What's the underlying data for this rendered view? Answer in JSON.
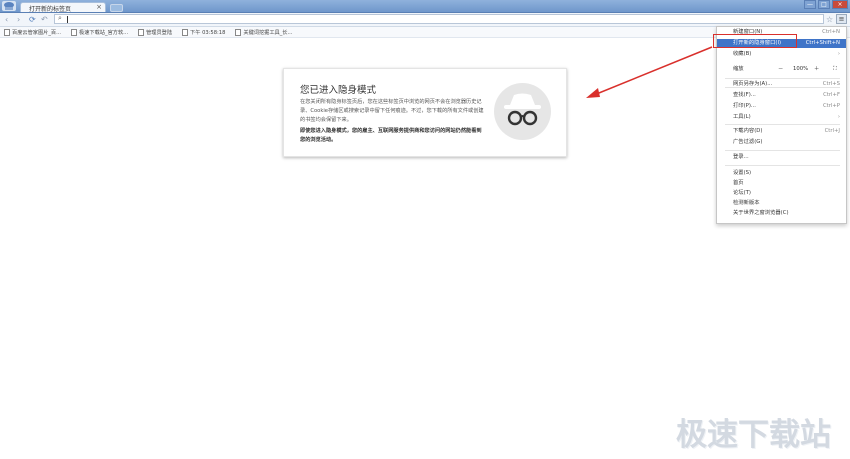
{
  "tab": {
    "title": "打开新的标签页",
    "close": "×"
  },
  "window_controls": {
    "minimize": "—",
    "maximize": "□",
    "close": "×"
  },
  "toolbar": {
    "back": "‹",
    "forward": "›",
    "reload": "⟳",
    "undo": "↶",
    "search": "⌕",
    "star": "☆",
    "menu": "≡"
  },
  "bookmarks": [
    {
      "label": "百度云管家图片_百..."
    },
    {
      "label": "极速下载站_官方软..."
    },
    {
      "label": "管理员登陆"
    },
    {
      "label": "下午 03:58:18"
    },
    {
      "label": "关键词挖掘工具_长..."
    }
  ],
  "card": {
    "title": "您已进入隐身模式",
    "text": "在您关闭所有隐身标签页后，您在这些标签页中浏览的网页不会在浏览器历史记录、Cookie存储区或搜索记录中留下任何痕迹。不过，您下载的所有文件或创建的书签均会保留下来。",
    "bold": "即使您进入隐身模式，您的雇主、互联网服务提供商和您访问的网站仍然能看到您的浏览活动。"
  },
  "menu": {
    "items": [
      {
        "label": "新建窗口(N)",
        "shortcut": "Ctrl+N"
      },
      {
        "label": "打开新的隐身窗口(I)",
        "shortcut": "Ctrl+Shift+N"
      },
      {
        "label": "收藏(B)",
        "shortcut": ""
      }
    ],
    "zoom": {
      "label": "缩放",
      "minus": "－",
      "value": "100%",
      "plus": "＋",
      "fullscreen": "⛶"
    },
    "items2": [
      {
        "label": "网页另存为(A)...",
        "shortcut": "Ctrl+S"
      },
      {
        "label": "查找(F)...",
        "shortcut": "Ctrl+F"
      },
      {
        "label": "打印(P)...",
        "shortcut": "Ctrl+P"
      },
      {
        "label": "工具(L)",
        "shortcut": ""
      }
    ],
    "items3": [
      {
        "label": "下载内容(D)",
        "shortcut": "Ctrl+J"
      },
      {
        "label": "广告过滤(G)",
        "shortcut": ""
      }
    ],
    "login": "登录...",
    "items4": [
      {
        "label": "设置(S)"
      },
      {
        "label": "首页"
      },
      {
        "label": "论坛(T)"
      },
      {
        "label": "检测新版本"
      },
      {
        "label": "关于世界之窗浏览器(C)"
      }
    ]
  },
  "watermark": "极速下载站",
  "colors": {
    "highlight": "#3f74c8",
    "annotation": "#d9302c",
    "tabstrip": "#7da2d4"
  }
}
